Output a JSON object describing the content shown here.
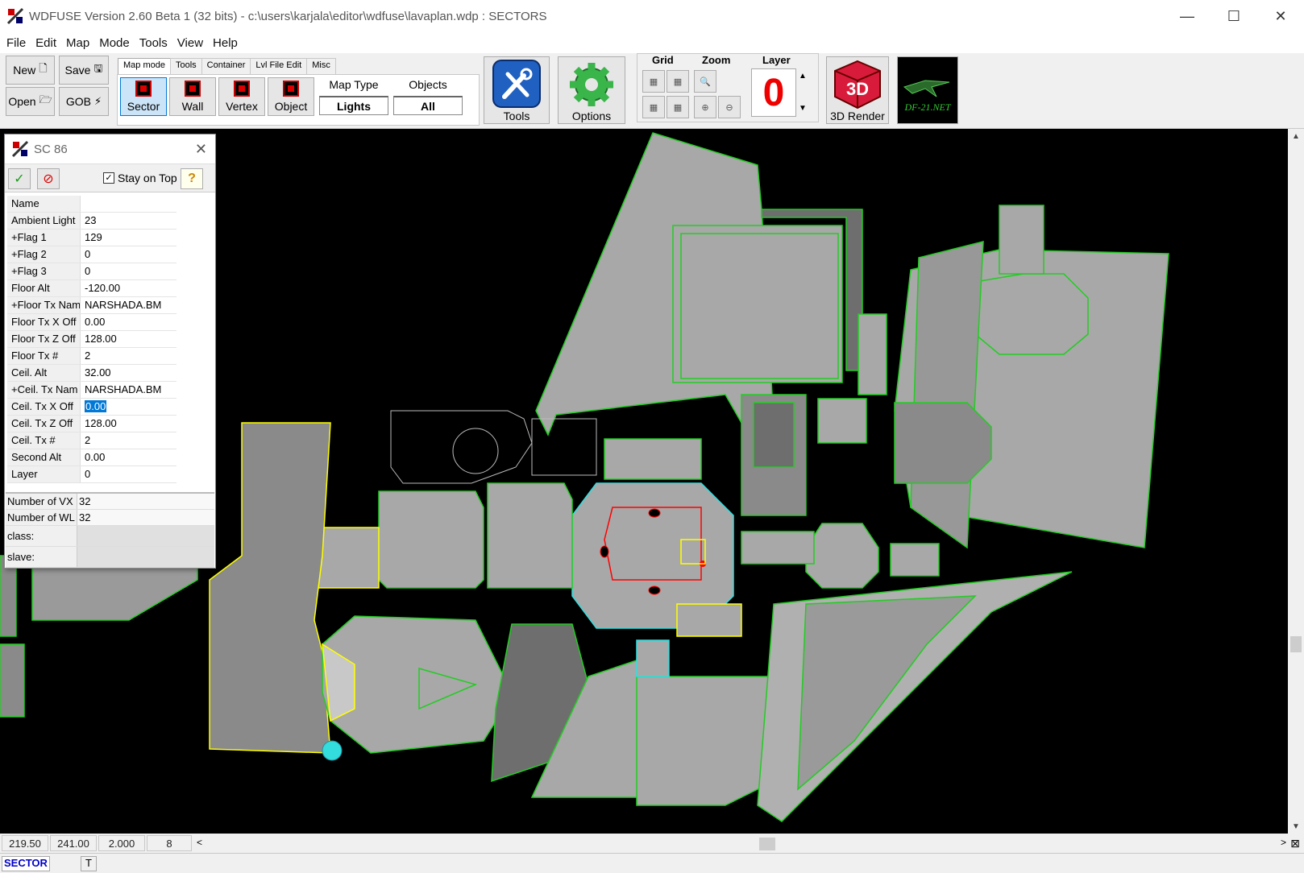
{
  "window": {
    "title": "WDFUSE Version 2.60 Beta 1 (32 bits) - c:\\users\\karjala\\editor\\wdfuse\\lavaplan.wdp : SECTORS",
    "minimize": "—",
    "maximize": "☐",
    "close": "✕"
  },
  "menu": [
    "File",
    "Edit",
    "Map",
    "Mode",
    "Tools",
    "View",
    "Help"
  ],
  "toolbar": {
    "new_label": "New",
    "save_label": "Save",
    "open_label": "Open",
    "gob_label": "GOB",
    "tabs": [
      "Map mode",
      "Tools",
      "Container",
      "Lvl File Edit",
      "Misc"
    ],
    "active_tab": "Map mode",
    "modes": [
      "Sector",
      "Wall",
      "Vertex",
      "Object"
    ],
    "active_mode": "Sector",
    "map_type_label": "Map Type",
    "map_type_value": "Lights",
    "objects_label": "Objects",
    "objects_value": "All",
    "tools_label": "Tools",
    "options_label": "Options",
    "grid_label": "Grid",
    "zoom_label": "Zoom",
    "layer_label": "Layer",
    "layer_value": "0",
    "render3d_label": "3D Render",
    "render3d_icon_text": "3D",
    "df21_text": "DF-21.NET"
  },
  "dialog": {
    "title": "SC 86",
    "stay_on_top_label": "Stay on Top",
    "stay_on_top_checked": true,
    "properties": [
      {
        "key": "Name",
        "value": ""
      },
      {
        "key": "Ambient Light",
        "value": "23"
      },
      {
        "key": "+Flag 1",
        "value": "129"
      },
      {
        "key": "+Flag 2",
        "value": "0"
      },
      {
        "key": "+Flag 3",
        "value": "0"
      },
      {
        "key": "Floor Alt",
        "value": "-120.00"
      },
      {
        "key": "+Floor Tx Nam",
        "value": "NARSHADA.BM"
      },
      {
        "key": "Floor Tx X Off",
        "value": "0.00"
      },
      {
        "key": "Floor Tx Z Off",
        "value": "128.00"
      },
      {
        "key": "Floor Tx #",
        "value": "2"
      },
      {
        "key": "Ceil. Alt",
        "value": "32.00"
      },
      {
        "key": "+Ceil. Tx Nam",
        "value": "NARSHADA.BM"
      },
      {
        "key": "Ceil. Tx X Off",
        "value": "0.00"
      },
      {
        "key": "Ceil. Tx Z Off",
        "value": "128.00"
      },
      {
        "key": "Ceil. Tx #",
        "value": "2"
      },
      {
        "key": "Second Alt",
        "value": "0.00"
      },
      {
        "key": "Layer",
        "value": "0"
      }
    ],
    "info": [
      {
        "key": "Number of VX",
        "value": "32"
      },
      {
        "key": "Number of WL",
        "value": "32"
      },
      {
        "key": "class:",
        "value": ""
      },
      {
        "key": "slave:",
        "value": ""
      }
    ]
  },
  "status": {
    "x": "219.50",
    "z": "241.00",
    "zoom": "2.000",
    "grid": "8",
    "mode": "SECTOR",
    "flag": "T"
  },
  "colors": {
    "map_bg": "#000000",
    "sector_fill": "#a8a8a8",
    "sector_dark": "#6e6e6e",
    "wall_green": "#22cc22",
    "wall_yellow": "#ffff00",
    "wall_cyan": "#33dddd",
    "selection_red": "#ff0000",
    "layer_red": "#ee0000",
    "sector_label_blue": "#0000c8"
  }
}
